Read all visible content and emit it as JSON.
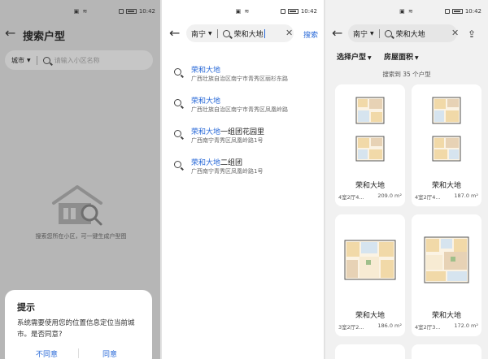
{
  "status": {
    "time": "10:42"
  },
  "panel1": {
    "title": "搜索户型",
    "city": "城市",
    "search_placeholder": "请输入小区名称",
    "empty_text": "搜索您所在小区，可一键生成户型图",
    "dialog": {
      "title": "提示",
      "message": "系统需要使用您的位置信息定位当前城市。是否同意?",
      "deny": "不同意",
      "agree": "同意"
    }
  },
  "panel2": {
    "city": "南宁",
    "query": "荣和大地",
    "search_label": "搜索",
    "results": [
      {
        "highlight": "荣和大地",
        "rest": "",
        "address": "广西壮族自治区南宁市青秀区丽杉东路"
      },
      {
        "highlight": "荣和大地",
        "rest": "",
        "address": "广西壮族自治区南宁市青秀区凤凰岭路"
      },
      {
        "highlight": "荣和大地",
        "rest": "一组团花园里",
        "address": "广西南宁青秀区凤凰岭路1号"
      },
      {
        "highlight": "荣和大地",
        "rest": "二组团",
        "address": "广西南宁青秀区凤凰岭路1号"
      }
    ]
  },
  "panel3": {
    "city": "南宁",
    "query": "荣和大地",
    "filter_type": "选择户型",
    "filter_area": "房屋面积",
    "result_count": "搜索到 35 个户型",
    "cards": [
      {
        "name": "荣和大地",
        "spec": "4室2厅4...",
        "area": "209.0 m²"
      },
      {
        "name": "荣和大地",
        "spec": "4室2厅4...",
        "area": "187.0 m²"
      },
      {
        "name": "荣和大地",
        "spec": "3室2厅2...",
        "area": "186.0 m²"
      },
      {
        "name": "荣和大地",
        "spec": "4室2厅3...",
        "area": "172.0 m²"
      }
    ]
  },
  "colors": {
    "accent": "#2a6ad8",
    "overlay": "#b6b6b6"
  },
  "icons": [
    "back-arrow-icon",
    "search-icon",
    "clear-icon",
    "house-search-icon",
    "chevron-down-icon"
  ]
}
